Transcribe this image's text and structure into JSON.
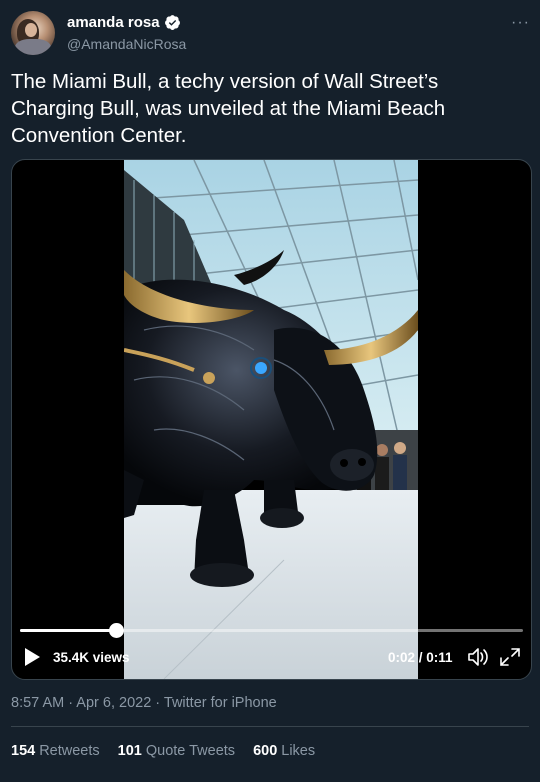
{
  "author": {
    "name": "amanda rosa",
    "handle": "@AmandaNicRosa",
    "verified_icon": "verified-badge-icon",
    "more_icon": "more-options-icon"
  },
  "tweet": {
    "text": "The Miami Bull, a techy version of Wall Street’s Charging Bull, was unveiled at the Miami Beach Convention Center."
  },
  "video": {
    "views": "35.4K views",
    "time": "0:02 / 0:11",
    "progress_fraction": 0.19,
    "play_icon": "play-icon",
    "volume_icon": "volume-icon",
    "fullscreen_icon": "fullscreen-icon"
  },
  "meta": {
    "time": "8:57 AM",
    "separator": " · ",
    "date": "Apr 6, 2022",
    "source": "Twitter for iPhone"
  },
  "stats": [
    {
      "value": "154",
      "label": "Retweets"
    },
    {
      "value": "101",
      "label": "Quote Tweets"
    },
    {
      "value": "600",
      "label": "Likes"
    }
  ],
  "colors": {
    "background": "#15202b",
    "secondary_text": "#8b98a5",
    "border": "#38444d",
    "verified": "#ffffff"
  }
}
